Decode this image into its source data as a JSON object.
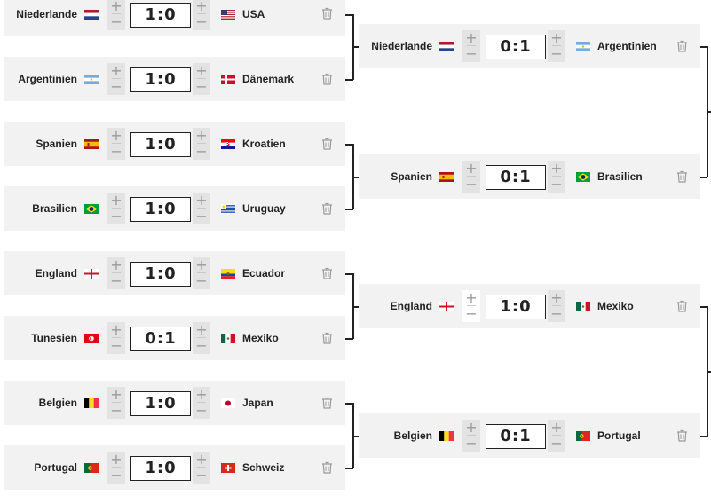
{
  "round_of_16": [
    {
      "home": "Niederlande",
      "home_flag": "netherlands-flag",
      "score": "1:0",
      "away": "USA",
      "away_flag": "usa-flag"
    },
    {
      "home": "Argentinien",
      "home_flag": "argentina-flag",
      "score": "1:0",
      "away": "Dänemark",
      "away_flag": "denmark-flag"
    },
    {
      "home": "Spanien",
      "home_flag": "spain-flag",
      "score": "1:0",
      "away": "Kroatien",
      "away_flag": "croatia-flag"
    },
    {
      "home": "Brasilien",
      "home_flag": "brazil-flag",
      "score": "1:0",
      "away": "Uruguay",
      "away_flag": "uruguay-flag"
    },
    {
      "home": "England",
      "home_flag": "england-flag",
      "score": "1:0",
      "away": "Ecuador",
      "away_flag": "ecuador-flag"
    },
    {
      "home": "Tunesien",
      "home_flag": "tunisia-flag",
      "score": "0:1",
      "away": "Mexiko",
      "away_flag": "mexico-flag"
    },
    {
      "home": "Belgien",
      "home_flag": "belgium-flag",
      "score": "1:0",
      "away": "Japan",
      "away_flag": "japan-flag"
    },
    {
      "home": "Portugal",
      "home_flag": "portugal-flag",
      "score": "1:0",
      "away": "Schweiz",
      "away_flag": "switzerland-flag"
    }
  ],
  "quarter_finals": [
    {
      "home": "Niederlande",
      "home_flag": "netherlands-flag",
      "score": "0:1",
      "away": "Argentinien",
      "away_flag": "argentina-flag"
    },
    {
      "home": "Spanien",
      "home_flag": "spain-flag",
      "score": "0:1",
      "away": "Brasilien",
      "away_flag": "brazil-flag"
    },
    {
      "home": "England",
      "home_flag": "england-flag",
      "score": "1:0",
      "away": "Mexiko",
      "away_flag": "mexico-flag"
    },
    {
      "home": "Belgien",
      "home_flag": "belgium-flag",
      "score": "0:1",
      "away": "Portugal",
      "away_flag": "portugal-flag"
    }
  ],
  "controls": {
    "plus": "+",
    "minus": "−"
  },
  "icons": {
    "delete": "trash-icon"
  },
  "colors": {
    "card_bg": "#f2f2f2",
    "stepper_bg": "#e3e3e3",
    "line": "#222222"
  }
}
